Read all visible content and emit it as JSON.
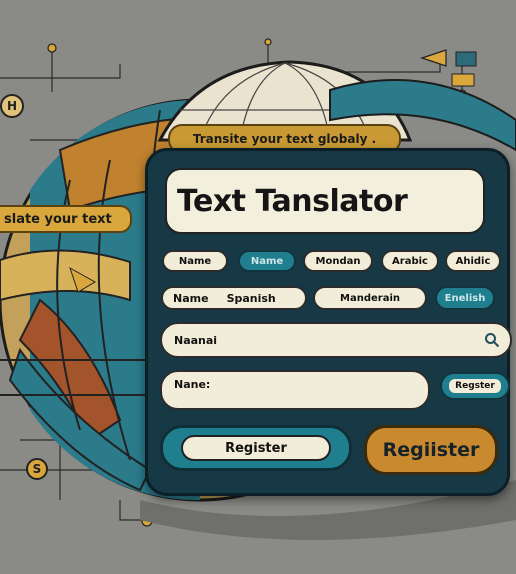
{
  "banner_top": "Transite your text globaly .",
  "banner_left": "slate your text",
  "title": "Text Tanslator",
  "language_row1": [
    "Name",
    "Name",
    "Mondan",
    "Arabic",
    "Ahidic"
  ],
  "language_row2": {
    "name_label": "Name",
    "name_value": "Spanish",
    "option_1": "Manderain",
    "option_2": "Enelish"
  },
  "search_field": {
    "value": "Naanai",
    "icon": "search-icon"
  },
  "name_field": {
    "label": "Nane:",
    "value": ""
  },
  "small_register": "Regster",
  "register_left": "Register",
  "register_right": "Regiister",
  "badges": {
    "h": "H",
    "s": "S"
  },
  "colors": {
    "background": "#8a8a86",
    "panel": "#173845",
    "teal": "#1f7f8e",
    "gold": "#c99a34",
    "cream": "#f1edd9"
  }
}
